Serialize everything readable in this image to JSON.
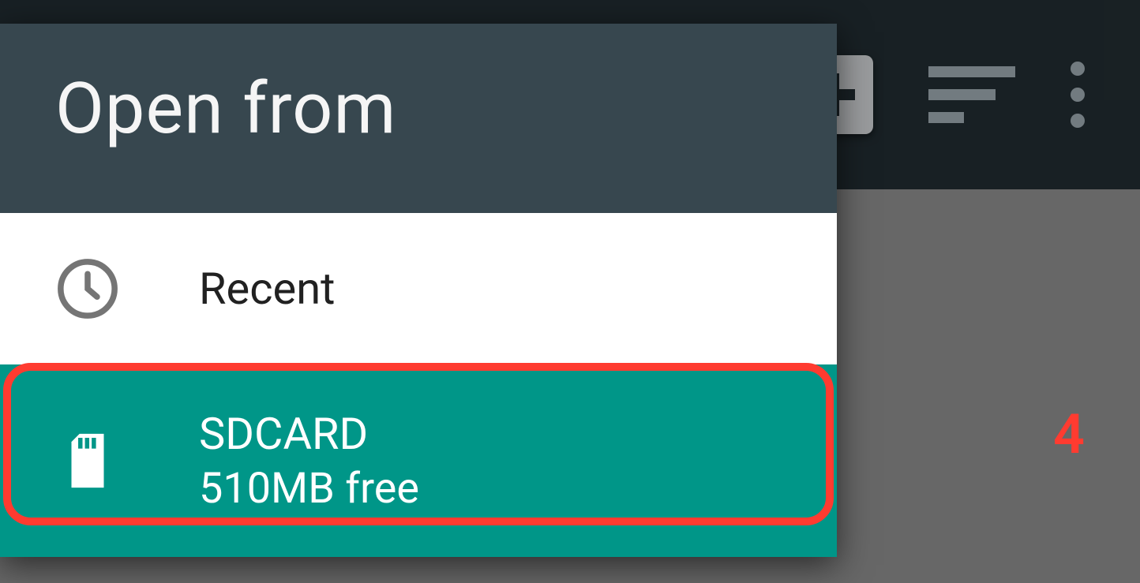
{
  "drawer": {
    "title": "Open from",
    "items": [
      {
        "icon": "clock-icon",
        "title": "Recent",
        "subtitle": null,
        "selected": false
      },
      {
        "icon": "sdcard-icon",
        "title": "SDCARD",
        "subtitle": "510MB free",
        "selected": true
      }
    ]
  },
  "annotation": {
    "label": "4"
  }
}
